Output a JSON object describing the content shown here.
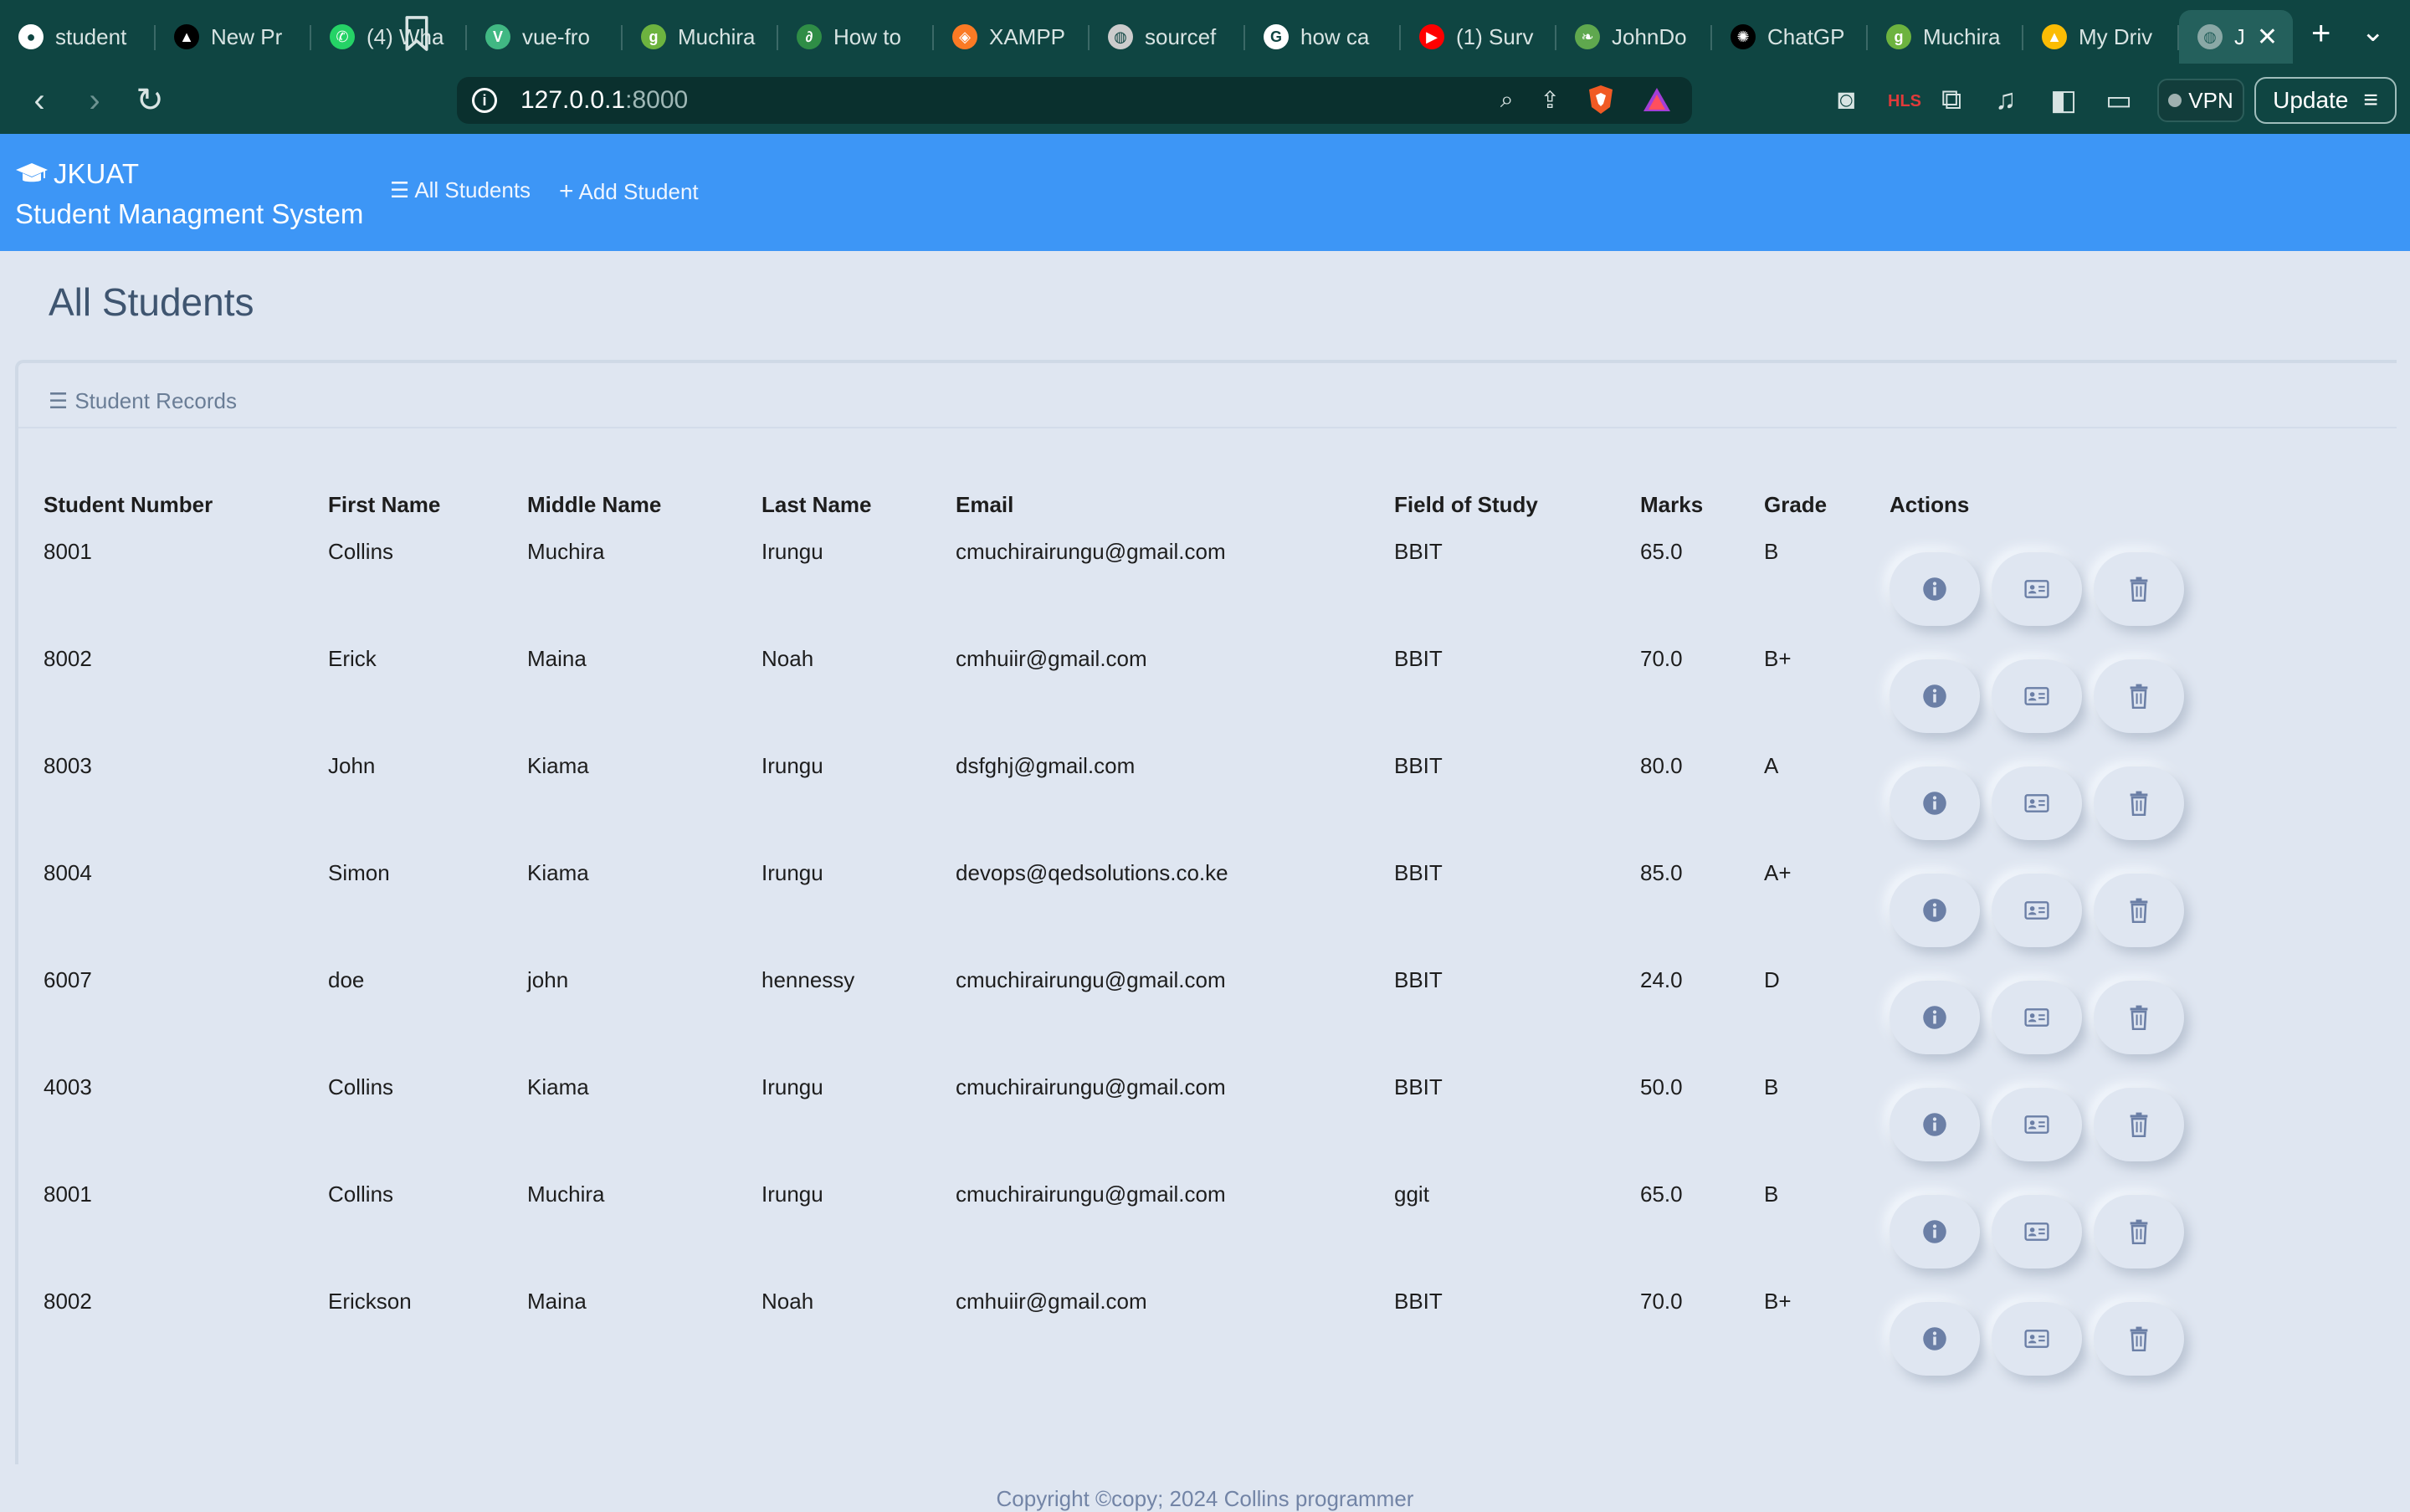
{
  "browser": {
    "tabs": [
      {
        "title": "student",
        "icon": "github-icon",
        "color": "#ffffff"
      },
      {
        "title": "New Pr",
        "icon": "vercel-icon",
        "color": "#000000"
      },
      {
        "title": "(4) Wha",
        "icon": "whatsapp-icon",
        "color": "#25d366"
      },
      {
        "title": "vue-fro",
        "icon": "vue-icon",
        "color": "#41b883"
      },
      {
        "title": "Muchira",
        "icon": "glitch-icon",
        "color": "#6db33f"
      },
      {
        "title": "How to",
        "icon": "geeksforgeeks-icon",
        "color": "#2f8d46"
      },
      {
        "title": "XAMPP",
        "icon": "xampp-icon",
        "color": "#fb7a24"
      },
      {
        "title": "sourcef",
        "icon": "globe-icon",
        "color": "#cccccc"
      },
      {
        "title": "how ca",
        "icon": "google-icon",
        "color": "#ffffff"
      },
      {
        "title": "(1) Surv",
        "icon": "youtube-icon",
        "color": "#ff0000"
      },
      {
        "title": "JohnDo",
        "icon": "leaf-icon",
        "color": "#5fa84e"
      },
      {
        "title": "ChatGP",
        "icon": "chatgpt-icon",
        "color": "#000000"
      },
      {
        "title": "Muchira",
        "icon": "glitch-icon",
        "color": "#6db33f"
      },
      {
        "title": "My Driv",
        "icon": "drive-icon",
        "color": "#fbbc04"
      }
    ],
    "active_tab": {
      "title": "JKU",
      "icon": "globe-icon"
    },
    "url_host": "127.0.0.1",
    "url_port": ":8000",
    "vpn_label": "VPN",
    "update_label": "Update"
  },
  "app": {
    "brand_name": "JKUAT",
    "brand_subtitle": "Student Managment System",
    "nav": {
      "all_students": "All Students",
      "add_student": "Add Student"
    },
    "page_title": "All Students",
    "card_title": "Student Records",
    "accent": "#3d96f6",
    "table": {
      "columns": [
        "Student Number",
        "First Name",
        "Middle Name",
        "Last Name",
        "Email",
        "Field of Study",
        "Marks",
        "Grade",
        "Actions"
      ],
      "rows": [
        [
          "8001",
          "Collins",
          "Muchira",
          "Irungu",
          "cmuchirairungu@gmail.com",
          "BBIT",
          "65.0",
          "B"
        ],
        [
          "8002",
          "Erick",
          "Maina",
          "Noah",
          "cmhuiir@gmail.com",
          "BBIT",
          "70.0",
          "B+"
        ],
        [
          "8003",
          "John",
          "Kiama",
          "Irungu",
          "dsfghj@gmail.com",
          "BBIT",
          "80.0",
          "A"
        ],
        [
          "8004",
          "Simon",
          "Kiama",
          "Irungu",
          "devops@qedsolutions.co.ke",
          "BBIT",
          "85.0",
          "A+"
        ],
        [
          "6007",
          "doe",
          "john",
          "hennessy",
          "cmuchirairungu@gmail.com",
          "BBIT",
          "24.0",
          "D"
        ],
        [
          "4003",
          "Collins",
          "Kiama",
          "Irungu",
          "cmuchirairungu@gmail.com",
          "BBIT",
          "50.0",
          "B"
        ],
        [
          "8001",
          "Collins",
          "Muchira",
          "Irungu",
          "cmuchirairungu@gmail.com",
          "ggit",
          "65.0",
          "B"
        ],
        [
          "8002",
          "Erickson",
          "Maina",
          "Noah",
          "cmhuiir@gmail.com",
          "BBIT",
          "70.0",
          "B+"
        ]
      ],
      "row_actions": [
        "info-icon",
        "id-card-icon",
        "trash-icon"
      ]
    },
    "footer": "Copyright ©copy; 2024 Collins programmer"
  }
}
